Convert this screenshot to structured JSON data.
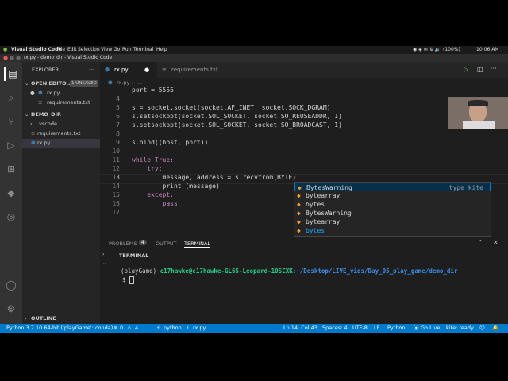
{
  "os_bar": {
    "app_name": "Visual Studio Code",
    "menus": [
      "File",
      "Edit",
      "Selection",
      "View",
      "Go",
      "Run",
      "Terminal",
      "Help"
    ],
    "battery": "(100%)",
    "time": "10:06 AM"
  },
  "window_title": "rx.py - demo_dir - Visual Studio Code",
  "sidebar": {
    "title": "EXPLORER",
    "open_editors_label": "OPEN EDITO...",
    "unsaved_badge": "1 UNSAVED",
    "open_files": [
      "rx.py",
      "requirements.txt"
    ],
    "folder_name": "DEMO_DIR",
    "tree": [
      ".vscode",
      "requirements.txt",
      "rx.py"
    ],
    "outline_label": "OUTLINE"
  },
  "tabs": [
    {
      "label": "rx.py",
      "active": true,
      "dirty_marker": "●"
    },
    {
      "label": "requirements.txt",
      "active": false
    }
  ],
  "breadcrumb": {
    "file": "rx.py",
    "more": "..."
  },
  "editor": {
    "lines": [
      {
        "no": "",
        "text": "port = 5555"
      },
      {
        "no": "4",
        "text": ""
      },
      {
        "no": "5",
        "text": "s = socket.socket(socket.AF_INET, socket.SOCK_DGRAM)"
      },
      {
        "no": "6",
        "text": "s.setsockopt(socket.SOL_SOCKET, socket.SO_REUSEADDR, 1)"
      },
      {
        "no": "7",
        "text": "s.setsockopt(socket.SOL_SOCKET, socket.SO_BROADCAST, 1)"
      },
      {
        "no": "8",
        "text": ""
      },
      {
        "no": "9",
        "text": "s.bind((host, port))"
      },
      {
        "no": "10",
        "text": ""
      },
      {
        "no": "11",
        "text": "while True:"
      },
      {
        "no": "12",
        "text": "    try:"
      },
      {
        "no": "13",
        "text": "        message, address = s.recvfrom(BYTE)"
      },
      {
        "no": "14",
        "text": "        print (message)"
      },
      {
        "no": "15",
        "text": "    except:"
      },
      {
        "no": "16",
        "text": "        pass"
      },
      {
        "no": "17",
        "text": ""
      }
    ]
  },
  "suggestions": {
    "items": [
      "BytesWarning",
      "bytearray",
      "bytes",
      "BytesWarning",
      "bytearray",
      "bytes"
    ],
    "type_hint": "type kite"
  },
  "panel": {
    "tabs": [
      "PROBLEMS",
      "OUTPUT",
      "TERMINAL"
    ],
    "problems_count": "4",
    "section_label": "TERMINAL",
    "prompt_env": "(playGame)",
    "prompt_userhost": "c17hawke@c17hawke-GL65-Leopard-10SCXK",
    "prompt_path": ":~/Desktop/LIVE_vids/Day_05_play_game/demo_dir",
    "prompt_symbol": "$"
  },
  "status_bar": {
    "interpreter": "Python 3.7.10 64-bit ('playGame': conda)",
    "errors": "0",
    "warnings": "4",
    "python_label": "python",
    "file": "rx.py",
    "position": "Ln 14, Col 43",
    "spaces": "Spaces: 4",
    "encoding": "UTF-8",
    "eol": "LF",
    "language": "Python",
    "go_live": "Go Live",
    "kite": "kite: ready"
  }
}
